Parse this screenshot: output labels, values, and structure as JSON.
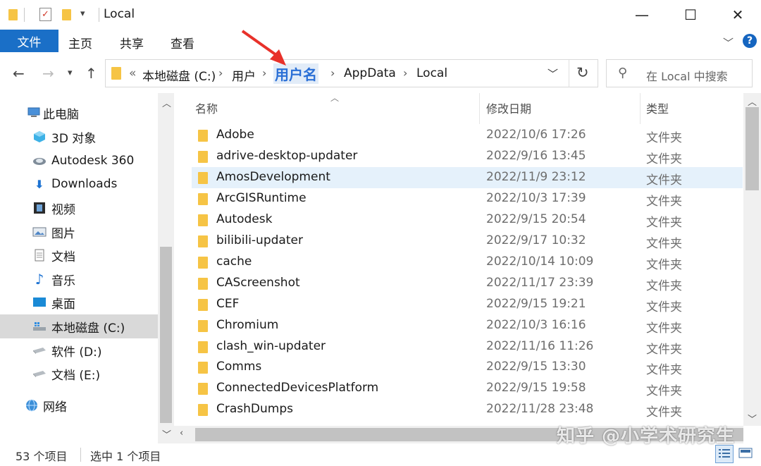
{
  "window": {
    "title": "Local",
    "minimize_glyph": "—",
    "maximize_glyph": "☐",
    "close_glyph": "✕"
  },
  "ribbon": {
    "tabs": [
      "文件",
      "主页",
      "共享",
      "查看"
    ],
    "help_glyph": "?"
  },
  "address": {
    "overflow": "«",
    "crumbs": [
      "本地磁盘 (C:)",
      "用户",
      "用户名",
      "AppData",
      "Local"
    ]
  },
  "search": {
    "placeholder": "在 Local 中搜索"
  },
  "sidebar": {
    "items": [
      {
        "label": "此电脑",
        "icon": "computer-icon"
      },
      {
        "label": "3D 对象",
        "icon": "cube-3d-icon"
      },
      {
        "label": "Autodesk 360",
        "icon": "cloud-drive-icon"
      },
      {
        "label": "Downloads",
        "icon": "download-arrow-icon"
      },
      {
        "label": "视频",
        "icon": "video-icon"
      },
      {
        "label": "图片",
        "icon": "picture-icon"
      },
      {
        "label": "文档",
        "icon": "document-icon"
      },
      {
        "label": "音乐",
        "icon": "music-note-icon"
      },
      {
        "label": "桌面",
        "icon": "desktop-icon"
      },
      {
        "label": "本地磁盘 (C:)",
        "icon": "system-drive-icon"
      },
      {
        "label": "软件 (D:)",
        "icon": "drive-icon"
      },
      {
        "label": "文档 (E:)",
        "icon": "drive-icon"
      },
      {
        "label": "网络",
        "icon": "network-icon"
      }
    ],
    "selected_index": 9
  },
  "list": {
    "columns": [
      "名称",
      "修改日期",
      "类型"
    ],
    "selected_index": 2,
    "rows": [
      {
        "name": "Adobe",
        "date": "2022/10/6 17:26",
        "type": "文件夹"
      },
      {
        "name": "adrive-desktop-updater",
        "date": "2022/9/16 13:45",
        "type": "文件夹"
      },
      {
        "name": "AmosDevelopment",
        "date": "2022/11/9 23:12",
        "type": "文件夹"
      },
      {
        "name": "ArcGISRuntime",
        "date": "2022/10/3 17:39",
        "type": "文件夹"
      },
      {
        "name": "Autodesk",
        "date": "2022/9/15 20:54",
        "type": "文件夹"
      },
      {
        "name": "bilibili-updater",
        "date": "2022/9/17 10:32",
        "type": "文件夹"
      },
      {
        "name": "cache",
        "date": "2022/10/14 10:09",
        "type": "文件夹"
      },
      {
        "name": "CAScreenshot",
        "date": "2022/11/17 23:39",
        "type": "文件夹"
      },
      {
        "name": "CEF",
        "date": "2022/9/15 19:21",
        "type": "文件夹"
      },
      {
        "name": "Chromium",
        "date": "2022/10/3 16:16",
        "type": "文件夹"
      },
      {
        "name": "clash_win-updater",
        "date": "2022/11/16 11:26",
        "type": "文件夹"
      },
      {
        "name": "Comms",
        "date": "2022/9/15 13:30",
        "type": "文件夹"
      },
      {
        "name": "ConnectedDevicesPlatform",
        "date": "2022/9/15 19:58",
        "type": "文件夹"
      },
      {
        "name": "CrashDumps",
        "date": "2022/11/28 23:48",
        "type": "文件夹"
      }
    ]
  },
  "status": {
    "item_count": "53 个项目",
    "selected": "选中 1 个项目"
  },
  "watermark": "知乎 @小学术研究生",
  "colors": {
    "accent": "#1a6fc7",
    "folder": "#f6c445",
    "selection": "#e5f1fb",
    "annotation_arrow": "#e8312a"
  }
}
